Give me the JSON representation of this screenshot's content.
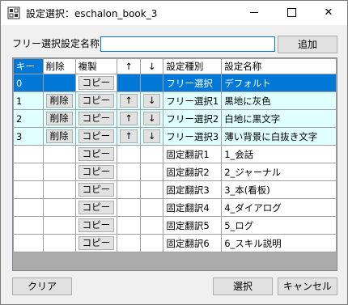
{
  "window": {
    "title": "設定選択：eschalon_book_3",
    "minimize": "—",
    "maximize": "□",
    "close": "✕"
  },
  "form": {
    "name_label": "フリー選択設定名称:",
    "name_value": "",
    "add_label": "追加"
  },
  "grid": {
    "headers": {
      "key": "キー",
      "delete": "削除",
      "copy": "複製",
      "up": "↑",
      "down": "↓",
      "type": "設定種別",
      "name": "設定名称"
    },
    "rows": [
      {
        "key": "0",
        "delete": "",
        "copy": "コピー",
        "up": "",
        "down": "",
        "type": "フリー選択",
        "name": "デフォルト"
      },
      {
        "key": "1",
        "delete": "削除",
        "copy": "コピー",
        "up": "↑",
        "down": "↓",
        "type": "フリー選択1",
        "name": "黒地に灰色"
      },
      {
        "key": "2",
        "delete": "削除",
        "copy": "コピー",
        "up": "↑",
        "down": "↓",
        "type": "フリー選択2",
        "name": "白地に黒文字"
      },
      {
        "key": "3",
        "delete": "削除",
        "copy": "コピー",
        "up": "↑",
        "down": "↓",
        "type": "フリー選択3",
        "name": "薄い背景に白抜き文字"
      },
      {
        "key": "",
        "delete": "",
        "copy": "コピー",
        "up": "",
        "down": "",
        "type": "固定翻訳1",
        "name": "1_会話"
      },
      {
        "key": "",
        "delete": "",
        "copy": "コピー",
        "up": "",
        "down": "",
        "type": "固定翻訳2",
        "name": "2_ジャーナル"
      },
      {
        "key": "",
        "delete": "",
        "copy": "コピー",
        "up": "",
        "down": "",
        "type": "固定翻訳3",
        "name": "3_本(看板)"
      },
      {
        "key": "",
        "delete": "",
        "copy": "コピー",
        "up": "",
        "down": "",
        "type": "固定翻訳4",
        "name": "4_ダイアログ"
      },
      {
        "key": "",
        "delete": "",
        "copy": "コピー",
        "up": "",
        "down": "",
        "type": "固定翻訳5",
        "name": "5_ログ"
      },
      {
        "key": "",
        "delete": "",
        "copy": "コピー",
        "up": "",
        "down": "",
        "type": "固定翻訳6",
        "name": "6_スキル説明"
      }
    ]
  },
  "footer": {
    "clear_label": "クリア",
    "select_label": "選択",
    "cancel_label": "キャンセル"
  },
  "colors": {
    "selection": "#0078d7",
    "free_row": "#e0ffff",
    "grid_empty": "#ababab"
  }
}
